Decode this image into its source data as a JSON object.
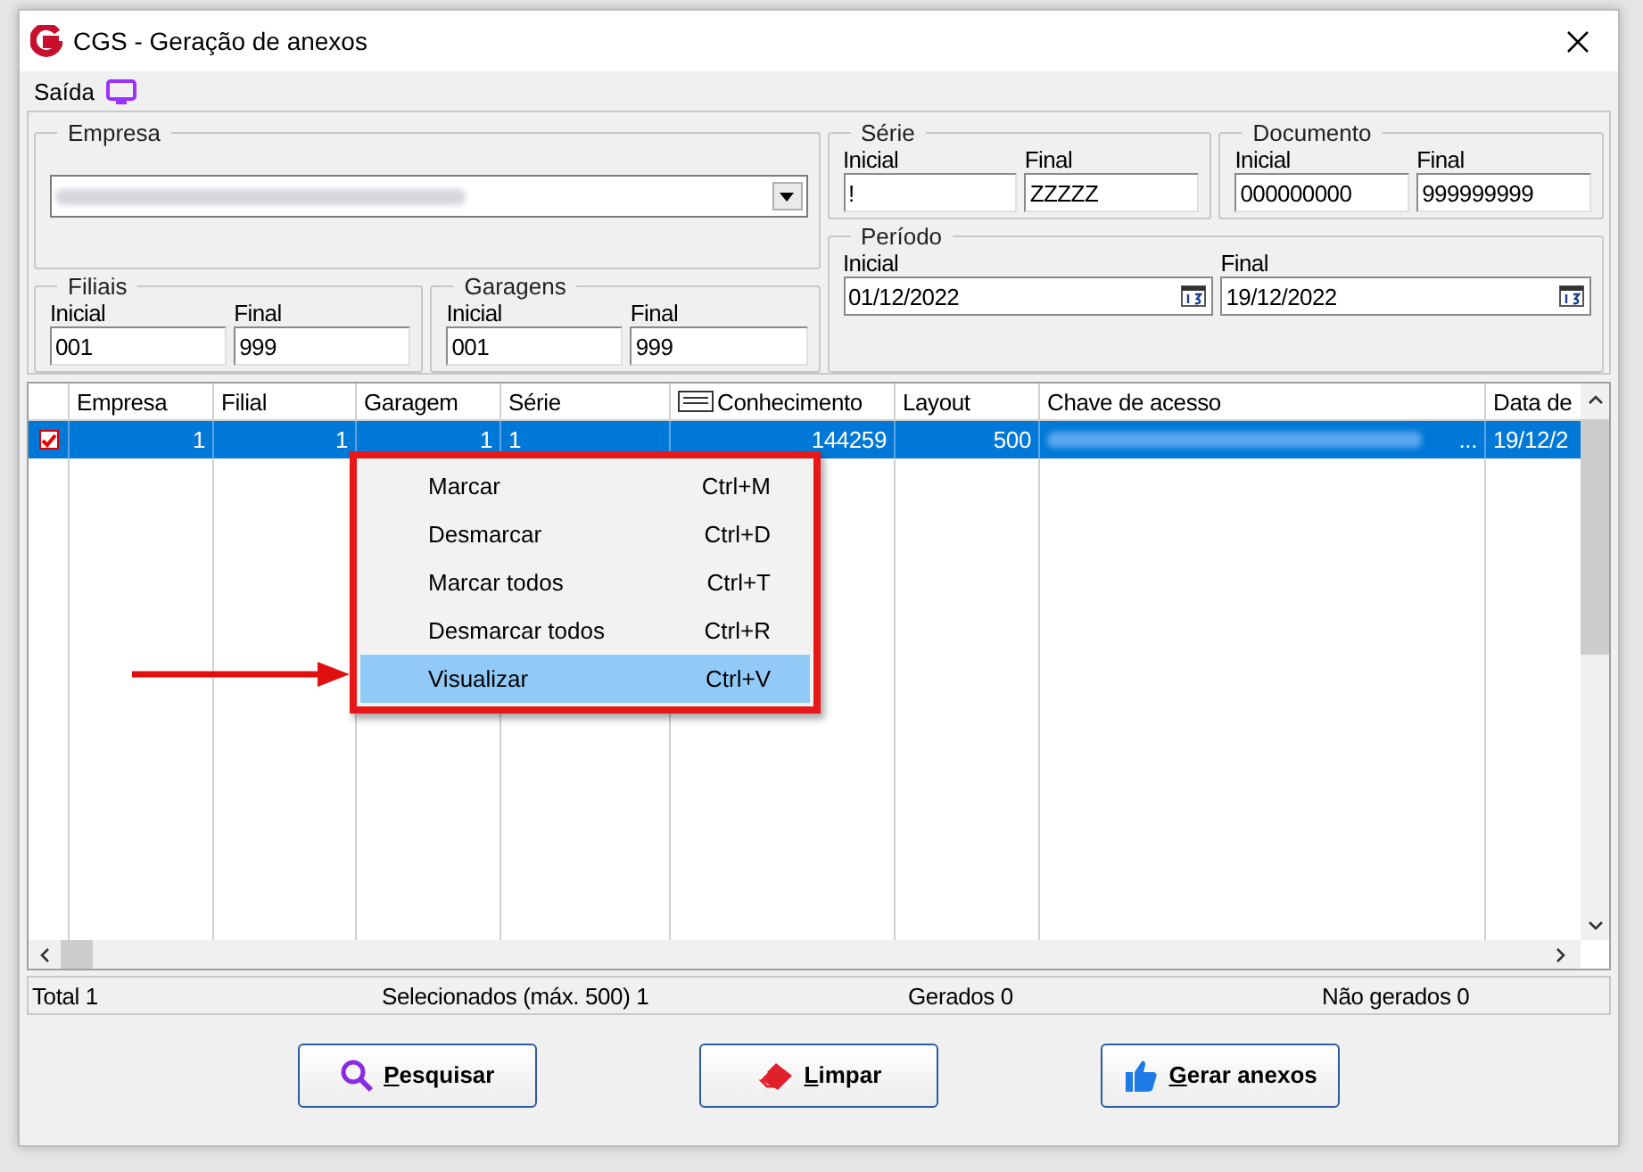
{
  "window": {
    "title": "CGS - Geração de anexos"
  },
  "menu": [
    {
      "label": "Saída"
    }
  ],
  "filters": {
    "empresa": {
      "label": "Empresa"
    },
    "groups": [
      {
        "label": "Filiais",
        "fields": [
          {
            "label": "Inicial",
            "value": "001"
          },
          {
            "label": "Final",
            "value": "999"
          }
        ]
      },
      {
        "label": "Garagens",
        "fields": [
          {
            "label": "Inicial",
            "value": "001"
          },
          {
            "label": "Final",
            "value": "999"
          }
        ]
      },
      {
        "label": "Série",
        "fields": [
          {
            "label": "Inicial",
            "value": "!"
          },
          {
            "label": "Final",
            "value": "ZZZZZ"
          }
        ]
      },
      {
        "label": "Documento",
        "fields": [
          {
            "label": "Inicial",
            "value": "000000000"
          },
          {
            "label": "Final",
            "value": "999999999"
          }
        ]
      }
    ],
    "period": {
      "label": "Período",
      "fields": [
        {
          "label": "Inicial",
          "value": "01/12/2022"
        },
        {
          "label": "Final",
          "value": "19/12/2022"
        }
      ]
    }
  },
  "table": {
    "columns": [
      {
        "label": "Empresa"
      },
      {
        "label": "Filial"
      },
      {
        "label": "Garagem"
      },
      {
        "label": "Série"
      },
      {
        "label": "Conhecimento"
      },
      {
        "label": "Layout"
      },
      {
        "label": "Chave de acesso"
      },
      {
        "label": "Data de"
      }
    ],
    "rows": [
      {
        "checked": true,
        "selected": true,
        "cells": [
          "1",
          "1",
          "1",
          "1",
          "144259",
          "500",
          "...",
          "19/12/2"
        ]
      }
    ]
  },
  "context_menu": [
    {
      "label": "Marcar",
      "shortcut": "Ctrl+M",
      "selected": false
    },
    {
      "label": "Desmarcar",
      "shortcut": "Ctrl+D",
      "selected": false
    },
    {
      "label": "Marcar todos",
      "shortcut": "Ctrl+T",
      "selected": false
    },
    {
      "label": "Desmarcar todos",
      "shortcut": "Ctrl+R",
      "selected": false
    },
    {
      "label": "Visualizar",
      "shortcut": "Ctrl+V",
      "selected": true
    }
  ],
  "status_bar": [
    "Total 1",
    "Selecionados (máx. 500) 1",
    "Gerados 0",
    "Não gerados 0"
  ],
  "buttons": [
    {
      "label": "Pesquisar",
      "kind": "search"
    },
    {
      "label": "Limpar",
      "kind": "clear"
    },
    {
      "label": "Gerar anexos",
      "kind": "generate"
    }
  ]
}
